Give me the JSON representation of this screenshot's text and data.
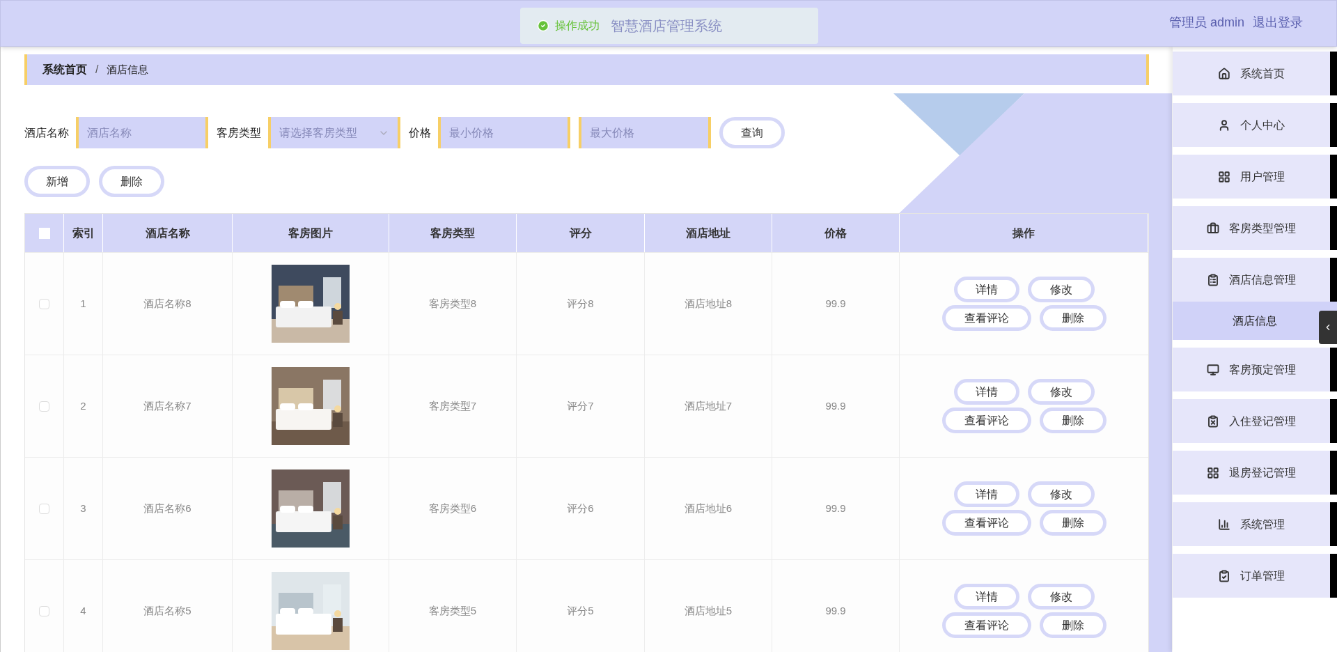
{
  "header": {
    "title": "智慧酒店管理系统",
    "user_label": "管理员 admin",
    "logout": "退出登录"
  },
  "toast": {
    "message": "操作成功"
  },
  "breadcrumb": [
    "系统首页",
    "/",
    "酒店信息"
  ],
  "search": {
    "fields": [
      {
        "kind": "input",
        "label": "酒店名称",
        "placeholder": "酒店名称"
      },
      {
        "kind": "select",
        "label": "客房类型",
        "placeholder": "请选择客房类型"
      },
      {
        "kind": "input",
        "label": "价格",
        "placeholder": "最小价格"
      },
      {
        "kind": "input",
        "placeholder": "最大价格"
      }
    ],
    "button": "查询"
  },
  "actions": [
    "新增",
    "删除"
  ],
  "table": {
    "columns": [
      "索引",
      "酒店名称",
      "客房图片",
      "客房类型",
      "评分",
      "酒店地址",
      "价格",
      "操作"
    ],
    "header_checked": false,
    "rows": [
      {
        "checked": false,
        "index": "1",
        "name": "酒店名称8",
        "type": "客房类型8",
        "rating": "评分8",
        "address": "酒店地址8",
        "price": "99.9",
        "buttons": [
          "详情",
          "修改",
          "查看评论",
          "删除"
        ]
      },
      {
        "checked": false,
        "index": "2",
        "name": "酒店名称7",
        "type": "客房类型7",
        "rating": "评分7",
        "address": "酒店地址7",
        "price": "99.9",
        "buttons": [
          "详情",
          "修改",
          "查看评论",
          "删除"
        ]
      },
      {
        "checked": false,
        "index": "3",
        "name": "酒店名称6",
        "type": "客房类型6",
        "rating": "评分6",
        "address": "酒店地址6",
        "price": "99.9",
        "buttons": [
          "详情",
          "修改",
          "查看评论",
          "删除"
        ]
      },
      {
        "checked": false,
        "index": "4",
        "name": "酒店名称5",
        "type": "客房类型5",
        "rating": "评分5",
        "address": "酒店地址5",
        "price": "99.9",
        "buttons": [
          "详情",
          "修改",
          "查看评论",
          "删除"
        ]
      }
    ]
  },
  "sidebar": {
    "items": [
      {
        "label": "系统首页",
        "selected": false
      },
      {
        "label": "个人中心",
        "selected": false
      },
      {
        "label": "用户管理",
        "selected": false
      },
      {
        "label": "客房类型管理",
        "selected": false
      },
      {
        "label": "酒店信息管理",
        "selected": false,
        "children": [
          {
            "label": "酒店信息",
            "selected": true
          }
        ]
      },
      {
        "label": "客房预定管理",
        "selected": false
      },
      {
        "label": "入住登记管理",
        "selected": false
      },
      {
        "label": "退房登记管理",
        "selected": false
      },
      {
        "label": "系统管理",
        "selected": false
      },
      {
        "label": "订单管理",
        "selected": false
      }
    ]
  }
}
